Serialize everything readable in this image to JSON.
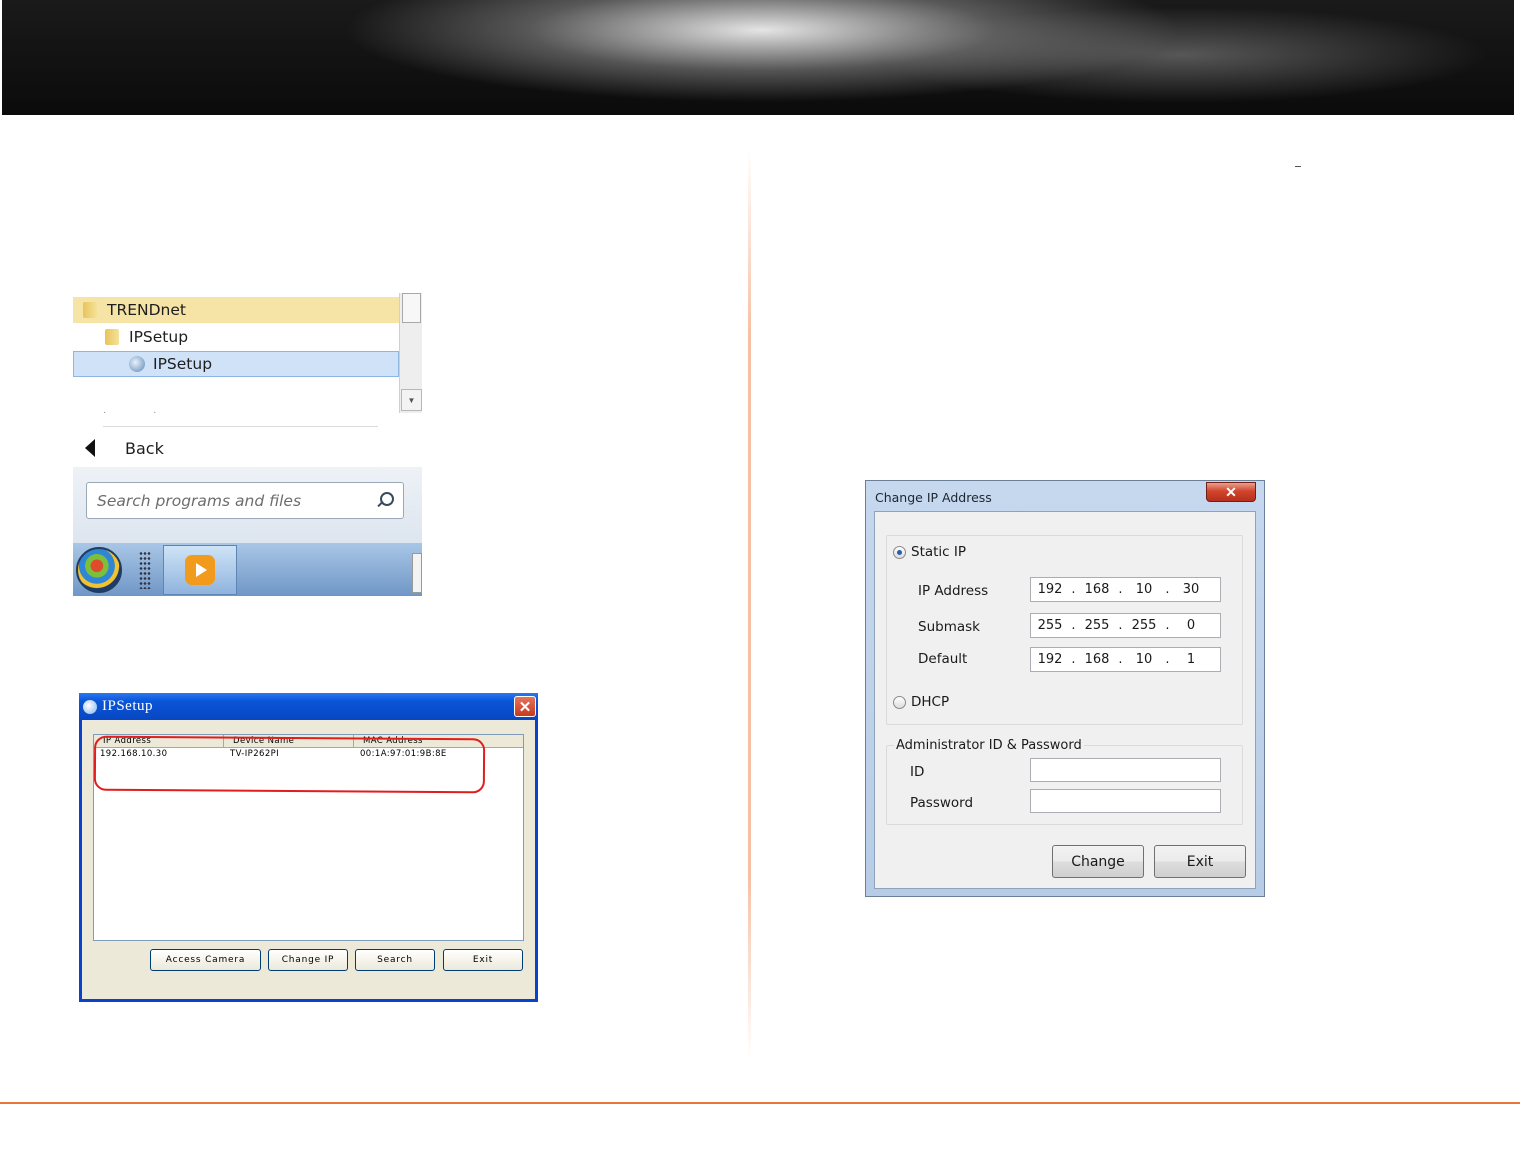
{
  "start_menu": {
    "items": [
      {
        "label": "TRENDnet",
        "kind": "folder"
      },
      {
        "label": "IPSetup",
        "kind": "folder"
      },
      {
        "label": "IPSetup",
        "kind": "program"
      }
    ],
    "back_label": "Back",
    "search_placeholder": "Search programs and files"
  },
  "ipsetup_window": {
    "title": "IPSetup",
    "close_glyph": "✕",
    "columns": [
      "IP Address",
      "Device Name",
      "MAC Address"
    ],
    "rows": [
      {
        "ip": "192.168.10.30",
        "device": "TV-IP262PI",
        "mac": "00:1A:97:01:9B:8E"
      }
    ],
    "highlight_color": "#e11d1d",
    "buttons": {
      "access": "Access  Camera",
      "change_ip": "Change IP",
      "search": "Search",
      "exit": "Exit"
    }
  },
  "change_ip_dialog": {
    "title": "Change IP Address",
    "close_glyph": "✕",
    "static_ip_label": "Static IP",
    "static_ip_selected": true,
    "ip_address": {
      "label": "IP Address",
      "octets": [
        "192",
        "168",
        "10",
        "30"
      ]
    },
    "submask": {
      "label": "Submask",
      "octets": [
        "255",
        "255",
        "255",
        "0"
      ]
    },
    "default": {
      "label": "Default",
      "octets": [
        "192",
        "168",
        "10",
        "1"
      ]
    },
    "dhcp_label": "DHCP",
    "credentials_group": "Administrator ID & Password",
    "id_label": "ID",
    "id_value": "",
    "password_label": "Password",
    "password_value": "",
    "buttons": {
      "change": "Change",
      "exit": "Exit"
    }
  },
  "colors": {
    "accent_orange": "#e8763a",
    "xp_title_blue": "#0a55d8"
  }
}
